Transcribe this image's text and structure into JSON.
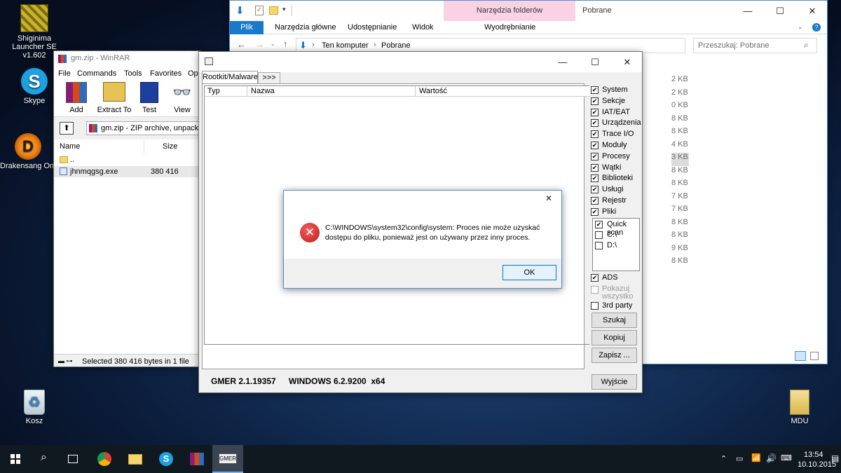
{
  "desktop": {
    "icons": [
      {
        "label": "Shiginima Launcher SE v1.602"
      },
      {
        "label": "Skype"
      },
      {
        "label": "Drakensang Online"
      },
      {
        "label": "Kosz"
      },
      {
        "label": "MDU"
      }
    ]
  },
  "explorer": {
    "ribbon_context_tab": "Narzędzia folderów skompresowanych",
    "title": "Pobrane",
    "tabs": [
      "Plik",
      "Narzędzia główne",
      "Udostępnianie",
      "Widok",
      "Wyodrębnianie"
    ],
    "path": [
      "Ten komputer",
      "Pobrane"
    ],
    "search_placeholder": "Przeszukaj: Pobrane",
    "sizes": [
      "2 KB",
      "2 KB",
      "0 KB",
      "8 KB",
      "8 KB",
      "4 KB",
      "3 KB",
      "8 KB",
      "8 KB",
      "7 KB",
      "7 KB",
      "8 KB",
      "8 KB",
      "9 KB",
      "8 KB"
    ]
  },
  "winrar": {
    "title": "gm.zip - WinRAR",
    "menu": [
      "File",
      "Commands",
      "Tools",
      "Favorites",
      "Opt"
    ],
    "toolbar": [
      "Add",
      "Extract To",
      "Test",
      "View"
    ],
    "path": "gm.zip - ZIP archive, unpacke",
    "columns": [
      "Name",
      "Size"
    ],
    "rows": [
      {
        "name": "..",
        "size": ""
      },
      {
        "name": "jhnmqgsg.exe",
        "size": "380 416"
      }
    ],
    "status": "Selected 380 416 bytes in 1 file"
  },
  "gmer": {
    "tabs": [
      "Rootkit/Malware",
      ">>>"
    ],
    "columns": [
      "Typ",
      "Nazwa",
      "Wartość"
    ],
    "options": [
      {
        "label": "System",
        "checked": true
      },
      {
        "label": "Sekcje",
        "checked": true
      },
      {
        "label": "IAT/EAT",
        "checked": true
      },
      {
        "label": "Urządzenia",
        "checked": true
      },
      {
        "label": "Trace I/O",
        "checked": true
      },
      {
        "label": "Moduły",
        "checked": true
      },
      {
        "label": "Procesy",
        "checked": true
      },
      {
        "label": "Wątki",
        "checked": true
      },
      {
        "label": "Biblioteki",
        "checked": true
      },
      {
        "label": "Usługi",
        "checked": true
      },
      {
        "label": "Rejestr",
        "checked": true
      },
      {
        "label": "Pliki",
        "checked": true
      }
    ],
    "drives": [
      {
        "label": "Quick scan",
        "checked": true
      },
      {
        "label": "C:\\",
        "checked": false
      },
      {
        "label": "D:\\",
        "checked": false
      }
    ],
    "ads": "ADS",
    "show_all": "Pokazuj wszystko",
    "third_party": "3rd party",
    "buttons": {
      "scan": "Szukaj",
      "copy": "Kopiuj",
      "save": "Zapisz ...",
      "exit": "Wyjście"
    },
    "status_version": "GMER 2.1.19357",
    "status_os": "WINDOWS 6.2.9200  x64"
  },
  "dialog": {
    "message_line1": "C:\\WINDOWS\\system32\\config\\system: Proces nie może uzyskać",
    "message_line2": "dostępu do pliku, ponieważ jest on używany przez inny proces.",
    "ok": "OK"
  },
  "taskbar": {
    "time": "13:54",
    "date": "10.10.2015",
    "gmer_label": "GMER"
  },
  "colors": {
    "accent": "#1979ca",
    "context_tab": "#f9d2e4",
    "error_red": "#d42828",
    "taskbar": "#101820"
  }
}
